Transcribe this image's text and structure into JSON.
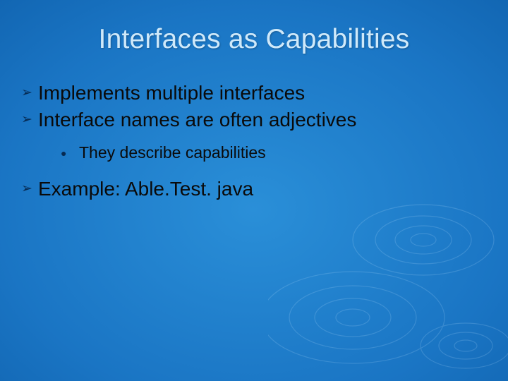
{
  "title": "Interfaces as Capabilities",
  "bullets": {
    "b1": "Implements multiple interfaces",
    "b2": "Interface names are often adjectives",
    "b2_sub1": "They describe capabilities",
    "b3": "Example: Able.Test. java"
  }
}
